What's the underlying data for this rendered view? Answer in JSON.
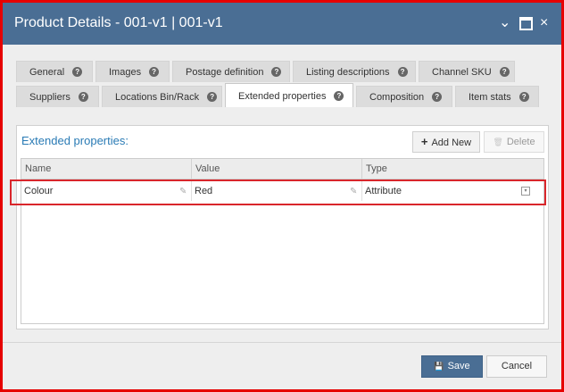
{
  "window": {
    "title": "Product Details - 001-v1 | 001-v1",
    "minimize_glyph": "⌄",
    "close_glyph": "×"
  },
  "tabs": {
    "row1": [
      {
        "label": "General"
      },
      {
        "label": "Images"
      },
      {
        "label": "Postage definition"
      },
      {
        "label": "Listing descriptions"
      },
      {
        "label": "Channel SKU"
      }
    ],
    "row2": [
      {
        "label": "Suppliers"
      },
      {
        "label": "Locations Bin/Rack"
      },
      {
        "label": "Extended properties",
        "active": true
      },
      {
        "label": "Composition"
      },
      {
        "label": "Item stats"
      }
    ],
    "help_glyph": "?"
  },
  "panel": {
    "title": "Extended properties:",
    "add_label": "Add New",
    "add_icon": "+",
    "delete_label": "Delete",
    "delete_icon": "🗑"
  },
  "grid": {
    "columns": [
      "Name",
      "Value",
      "Type"
    ],
    "rows": [
      {
        "name": "Colour",
        "value": "Red",
        "type": "Attribute"
      }
    ],
    "edit_glyph": "✎",
    "dropdown_glyph": "▾"
  },
  "footer": {
    "save_label": "Save",
    "save_icon": "💾",
    "cancel_label": "Cancel"
  },
  "colors": {
    "titlebar": "#4a6e94",
    "accent": "#2a7bb5",
    "highlight_border": "#d9262b",
    "frame_border": "#e60000"
  }
}
